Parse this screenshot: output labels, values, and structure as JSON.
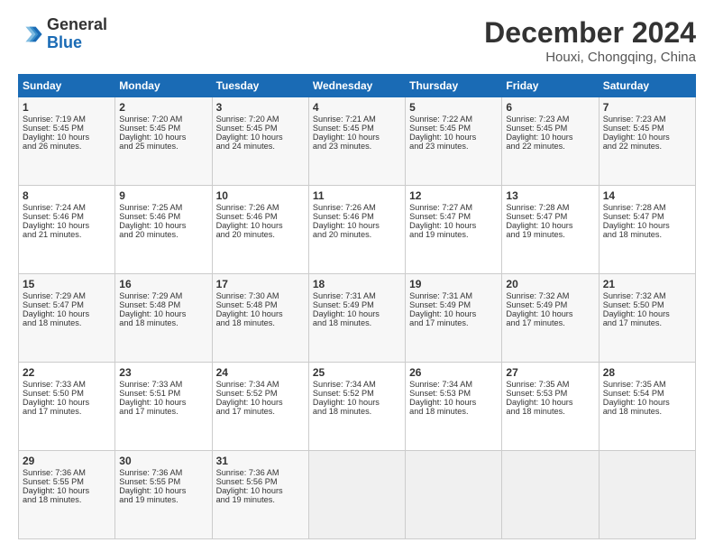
{
  "header": {
    "logo_text_general": "General",
    "logo_text_blue": "Blue",
    "title": "December 2024",
    "subtitle": "Houxi, Chongqing, China"
  },
  "weekdays": [
    "Sunday",
    "Monday",
    "Tuesday",
    "Wednesday",
    "Thursday",
    "Friday",
    "Saturday"
  ],
  "weeks": [
    [
      {
        "day": "1",
        "lines": [
          "Sunrise: 7:19 AM",
          "Sunset: 5:45 PM",
          "Daylight: 10 hours",
          "and 26 minutes."
        ]
      },
      {
        "day": "2",
        "lines": [
          "Sunrise: 7:20 AM",
          "Sunset: 5:45 PM",
          "Daylight: 10 hours",
          "and 25 minutes."
        ]
      },
      {
        "day": "3",
        "lines": [
          "Sunrise: 7:20 AM",
          "Sunset: 5:45 PM",
          "Daylight: 10 hours",
          "and 24 minutes."
        ]
      },
      {
        "day": "4",
        "lines": [
          "Sunrise: 7:21 AM",
          "Sunset: 5:45 PM",
          "Daylight: 10 hours",
          "and 23 minutes."
        ]
      },
      {
        "day": "5",
        "lines": [
          "Sunrise: 7:22 AM",
          "Sunset: 5:45 PM",
          "Daylight: 10 hours",
          "and 23 minutes."
        ]
      },
      {
        "day": "6",
        "lines": [
          "Sunrise: 7:23 AM",
          "Sunset: 5:45 PM",
          "Daylight: 10 hours",
          "and 22 minutes."
        ]
      },
      {
        "day": "7",
        "lines": [
          "Sunrise: 7:23 AM",
          "Sunset: 5:45 PM",
          "Daylight: 10 hours",
          "and 22 minutes."
        ]
      }
    ],
    [
      {
        "day": "8",
        "lines": [
          "Sunrise: 7:24 AM",
          "Sunset: 5:46 PM",
          "Daylight: 10 hours",
          "and 21 minutes."
        ]
      },
      {
        "day": "9",
        "lines": [
          "Sunrise: 7:25 AM",
          "Sunset: 5:46 PM",
          "Daylight: 10 hours",
          "and 20 minutes."
        ]
      },
      {
        "day": "10",
        "lines": [
          "Sunrise: 7:26 AM",
          "Sunset: 5:46 PM",
          "Daylight: 10 hours",
          "and 20 minutes."
        ]
      },
      {
        "day": "11",
        "lines": [
          "Sunrise: 7:26 AM",
          "Sunset: 5:46 PM",
          "Daylight: 10 hours",
          "and 20 minutes."
        ]
      },
      {
        "day": "12",
        "lines": [
          "Sunrise: 7:27 AM",
          "Sunset: 5:47 PM",
          "Daylight: 10 hours",
          "and 19 minutes."
        ]
      },
      {
        "day": "13",
        "lines": [
          "Sunrise: 7:28 AM",
          "Sunset: 5:47 PM",
          "Daylight: 10 hours",
          "and 19 minutes."
        ]
      },
      {
        "day": "14",
        "lines": [
          "Sunrise: 7:28 AM",
          "Sunset: 5:47 PM",
          "Daylight: 10 hours",
          "and 18 minutes."
        ]
      }
    ],
    [
      {
        "day": "15",
        "lines": [
          "Sunrise: 7:29 AM",
          "Sunset: 5:47 PM",
          "Daylight: 10 hours",
          "and 18 minutes."
        ]
      },
      {
        "day": "16",
        "lines": [
          "Sunrise: 7:29 AM",
          "Sunset: 5:48 PM",
          "Daylight: 10 hours",
          "and 18 minutes."
        ]
      },
      {
        "day": "17",
        "lines": [
          "Sunrise: 7:30 AM",
          "Sunset: 5:48 PM",
          "Daylight: 10 hours",
          "and 18 minutes."
        ]
      },
      {
        "day": "18",
        "lines": [
          "Sunrise: 7:31 AM",
          "Sunset: 5:49 PM",
          "Daylight: 10 hours",
          "and 18 minutes."
        ]
      },
      {
        "day": "19",
        "lines": [
          "Sunrise: 7:31 AM",
          "Sunset: 5:49 PM",
          "Daylight: 10 hours",
          "and 17 minutes."
        ]
      },
      {
        "day": "20",
        "lines": [
          "Sunrise: 7:32 AM",
          "Sunset: 5:49 PM",
          "Daylight: 10 hours",
          "and 17 minutes."
        ]
      },
      {
        "day": "21",
        "lines": [
          "Sunrise: 7:32 AM",
          "Sunset: 5:50 PM",
          "Daylight: 10 hours",
          "and 17 minutes."
        ]
      }
    ],
    [
      {
        "day": "22",
        "lines": [
          "Sunrise: 7:33 AM",
          "Sunset: 5:50 PM",
          "Daylight: 10 hours",
          "and 17 minutes."
        ]
      },
      {
        "day": "23",
        "lines": [
          "Sunrise: 7:33 AM",
          "Sunset: 5:51 PM",
          "Daylight: 10 hours",
          "and 17 minutes."
        ]
      },
      {
        "day": "24",
        "lines": [
          "Sunrise: 7:34 AM",
          "Sunset: 5:52 PM",
          "Daylight: 10 hours",
          "and 17 minutes."
        ]
      },
      {
        "day": "25",
        "lines": [
          "Sunrise: 7:34 AM",
          "Sunset: 5:52 PM",
          "Daylight: 10 hours",
          "and 18 minutes."
        ]
      },
      {
        "day": "26",
        "lines": [
          "Sunrise: 7:34 AM",
          "Sunset: 5:53 PM",
          "Daylight: 10 hours",
          "and 18 minutes."
        ]
      },
      {
        "day": "27",
        "lines": [
          "Sunrise: 7:35 AM",
          "Sunset: 5:53 PM",
          "Daylight: 10 hours",
          "and 18 minutes."
        ]
      },
      {
        "day": "28",
        "lines": [
          "Sunrise: 7:35 AM",
          "Sunset: 5:54 PM",
          "Daylight: 10 hours",
          "and 18 minutes."
        ]
      }
    ],
    [
      {
        "day": "29",
        "lines": [
          "Sunrise: 7:36 AM",
          "Sunset: 5:55 PM",
          "Daylight: 10 hours",
          "and 18 minutes."
        ]
      },
      {
        "day": "30",
        "lines": [
          "Sunrise: 7:36 AM",
          "Sunset: 5:55 PM",
          "Daylight: 10 hours",
          "and 19 minutes."
        ]
      },
      {
        "day": "31",
        "lines": [
          "Sunrise: 7:36 AM",
          "Sunset: 5:56 PM",
          "Daylight: 10 hours",
          "and 19 minutes."
        ]
      },
      {
        "day": "",
        "lines": []
      },
      {
        "day": "",
        "lines": []
      },
      {
        "day": "",
        "lines": []
      },
      {
        "day": "",
        "lines": []
      }
    ]
  ]
}
